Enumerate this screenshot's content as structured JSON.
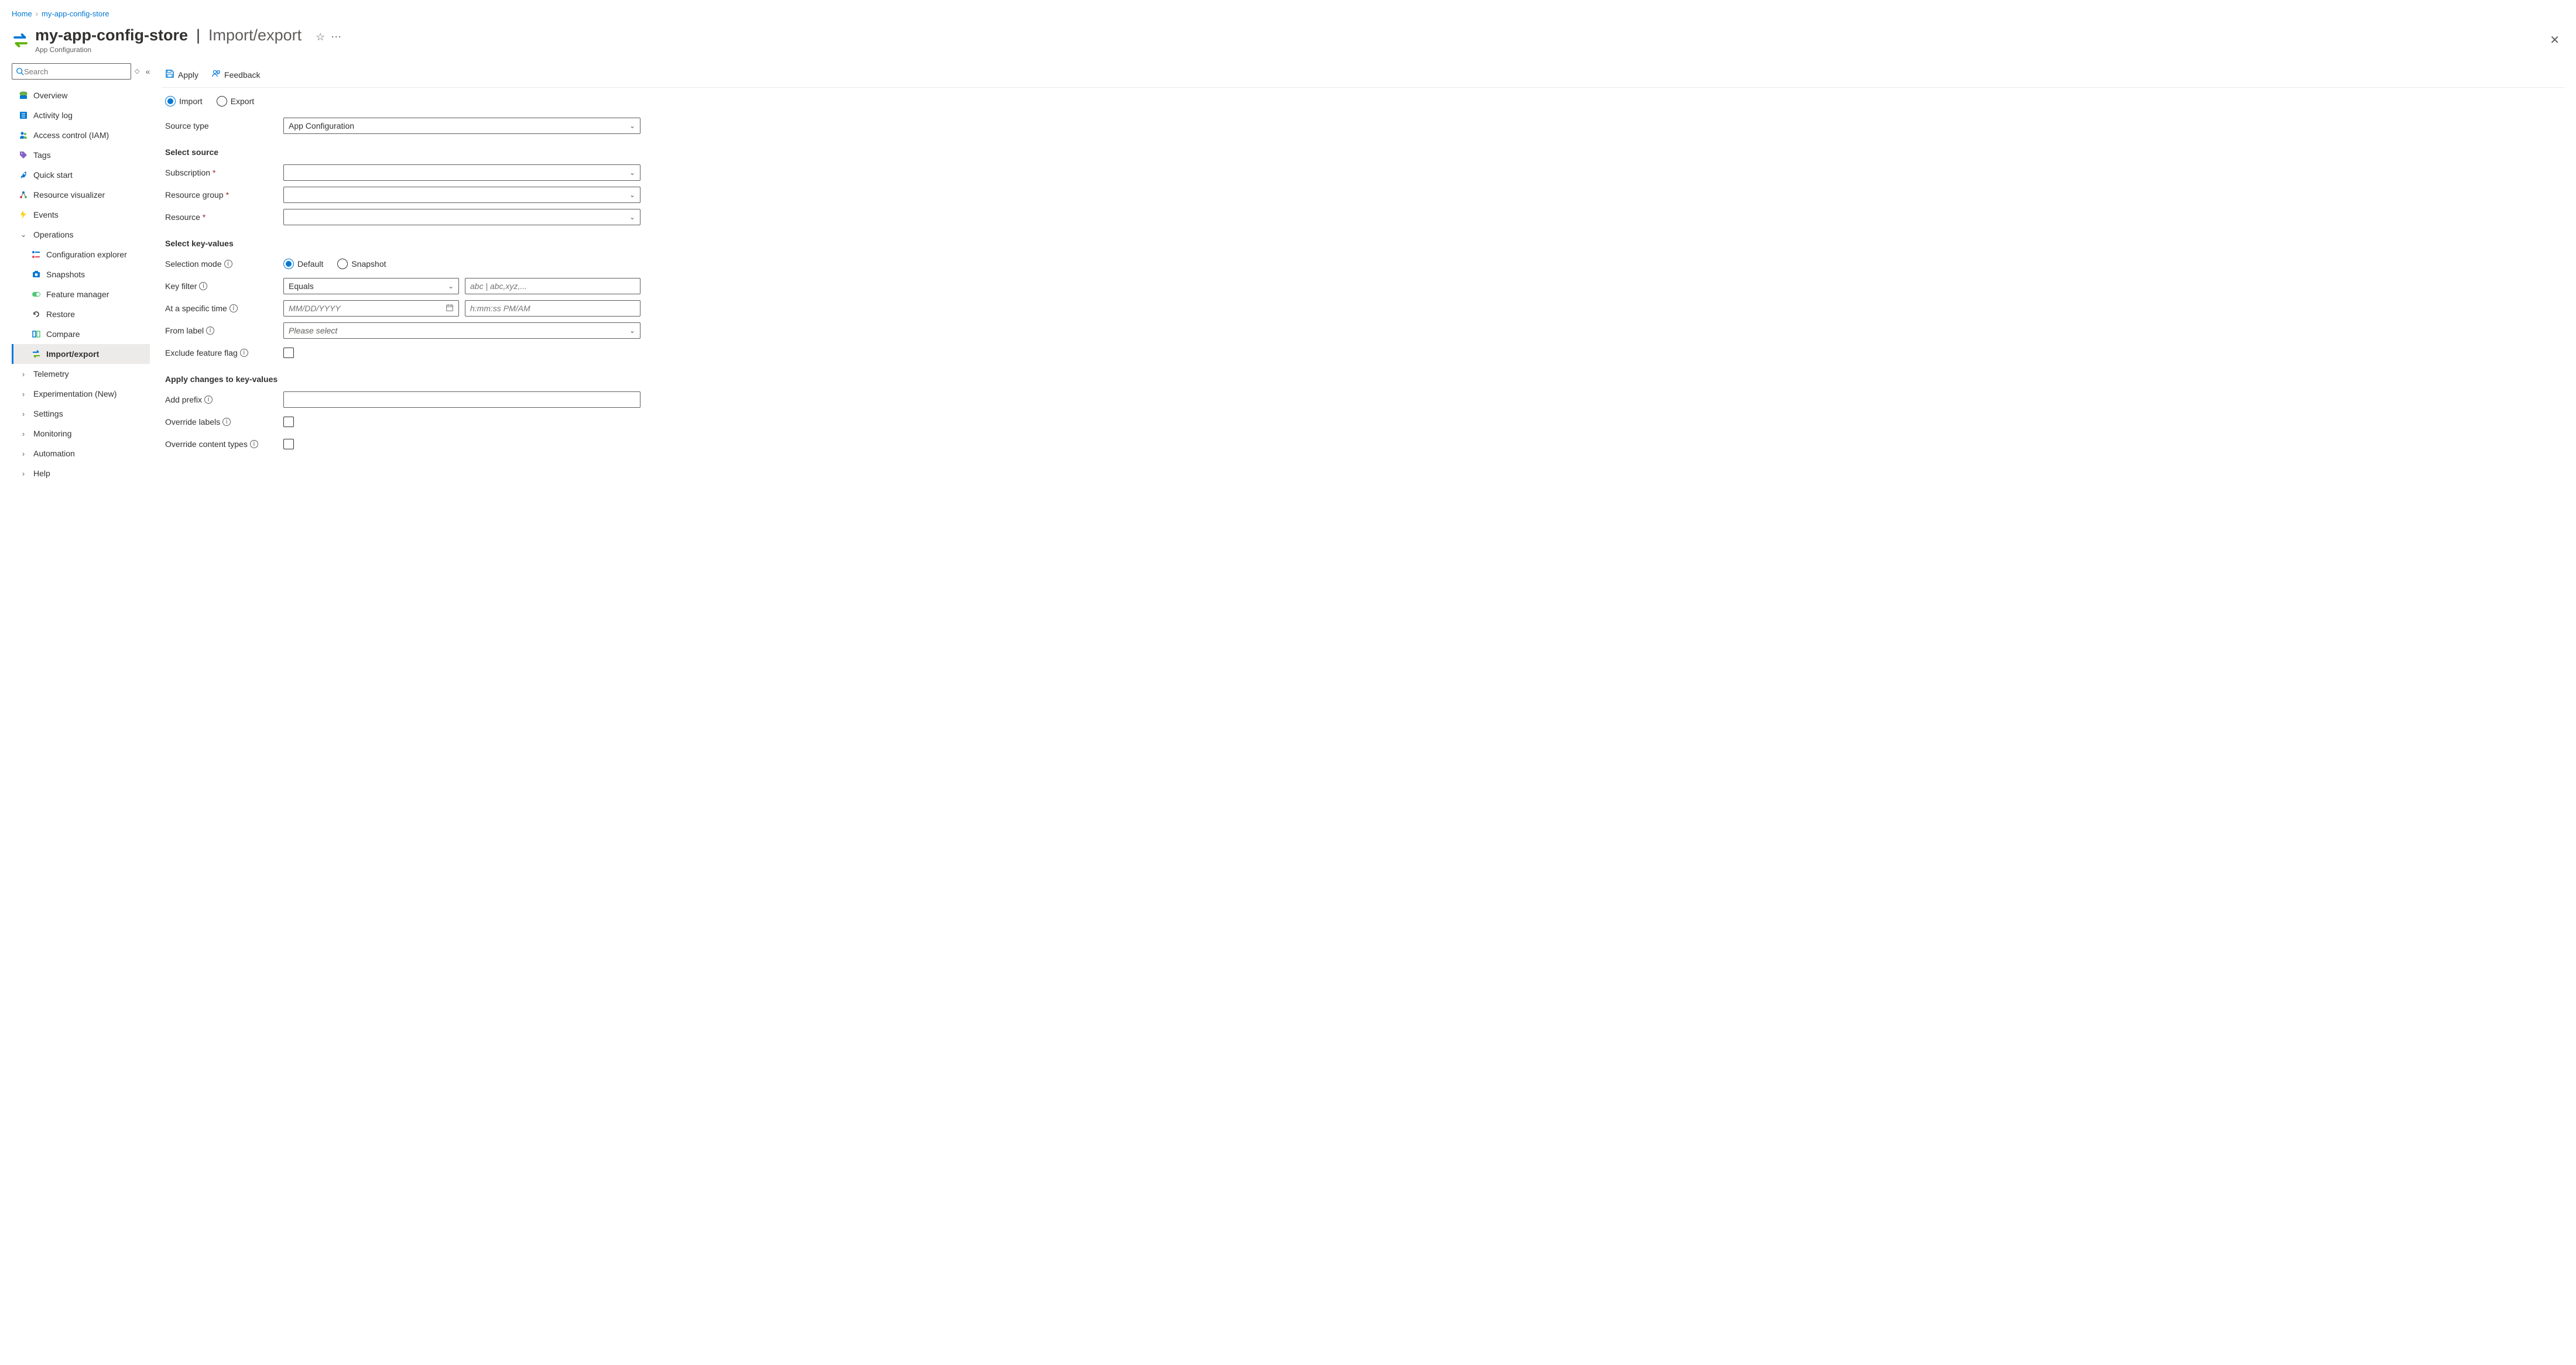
{
  "breadcrumb": {
    "home": "Home",
    "resource": "my-app-config-store"
  },
  "header": {
    "title": "my-app-config-store",
    "section": "Import/export",
    "subtitle": "App Configuration"
  },
  "sidebar": {
    "search_placeholder": "Search",
    "items": {
      "overview": "Overview",
      "activity": "Activity log",
      "iam": "Access control (IAM)",
      "tags": "Tags",
      "quickstart": "Quick start",
      "visualizer": "Resource visualizer",
      "events": "Events"
    },
    "groups": {
      "operations": "Operations",
      "telemetry": "Telemetry",
      "experimentation": "Experimentation (New)",
      "settings": "Settings",
      "monitoring": "Monitoring",
      "automation": "Automation",
      "help": "Help"
    },
    "ops_children": {
      "config_explorer": "Configuration explorer",
      "snapshots": "Snapshots",
      "feature_manager": "Feature manager",
      "restore": "Restore",
      "compare": "Compare",
      "import_export": "Import/export"
    }
  },
  "commands": {
    "apply": "Apply",
    "feedback": "Feedback"
  },
  "form": {
    "radio_import": "Import",
    "radio_export": "Export",
    "source_type_label": "Source type",
    "source_type_value": "App Configuration",
    "section_select_source": "Select source",
    "subscription_label": "Subscription",
    "resource_group_label": "Resource group",
    "resource_label": "Resource",
    "section_select_kv": "Select key-values",
    "selection_mode_label": "Selection mode",
    "radio_default": "Default",
    "radio_snapshot": "Snapshot",
    "key_filter_label": "Key filter",
    "key_filter_op": "Equals",
    "key_filter_placeholder": "abc | abc,xyz,...",
    "specific_time_label": "At a specific time",
    "date_placeholder": "MM/DD/YYYY",
    "time_placeholder": "h:mm:ss PM/AM",
    "from_label_label": "From label",
    "from_label_placeholder": "Please select",
    "exclude_flag_label": "Exclude feature flag",
    "section_apply_changes": "Apply changes to key-values",
    "add_prefix_label": "Add prefix",
    "override_labels_label": "Override labels",
    "override_ct_label": "Override content types"
  }
}
